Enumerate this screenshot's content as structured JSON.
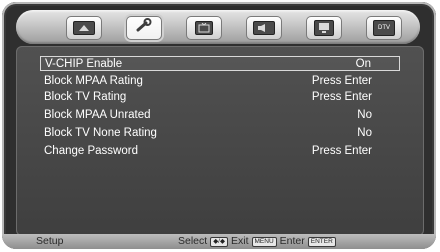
{
  "menu": {
    "tabs": [
      {
        "icon": "picture-icon",
        "active": false
      },
      {
        "icon": "setup-wrench-icon",
        "active": true
      },
      {
        "icon": "tv-icon",
        "active": false
      },
      {
        "icon": "audio-icon",
        "active": false
      },
      {
        "icon": "monitor-icon",
        "active": false
      },
      {
        "icon": "dtv-icon",
        "label": "DTV",
        "active": false
      }
    ],
    "rows": [
      {
        "label": "V-CHIP Enable",
        "value": "On",
        "selected": true
      },
      {
        "label": "Block MPAA Rating",
        "value": "Press Enter",
        "selected": false
      },
      {
        "label": "Block TV Rating",
        "value": "Press Enter",
        "selected": false
      },
      {
        "label": "Block MPAA Unrated",
        "value": "No",
        "selected": false
      },
      {
        "label": "Block TV None Rating",
        "value": "No",
        "selected": false
      },
      {
        "label": "Change Password",
        "value": "Press Enter",
        "selected": false
      }
    ]
  },
  "status": {
    "title": "Setup",
    "select_text": "Select",
    "select_key": "◆/◆",
    "exit_text": "Exit",
    "exit_key": "MENU",
    "enter_text": "Enter",
    "enter_key": "ENTER"
  },
  "colors": {
    "panel": "#464646",
    "frame": "#2f2f2f",
    "text": "#ffffff",
    "statusbar": "#a7a7a7"
  }
}
